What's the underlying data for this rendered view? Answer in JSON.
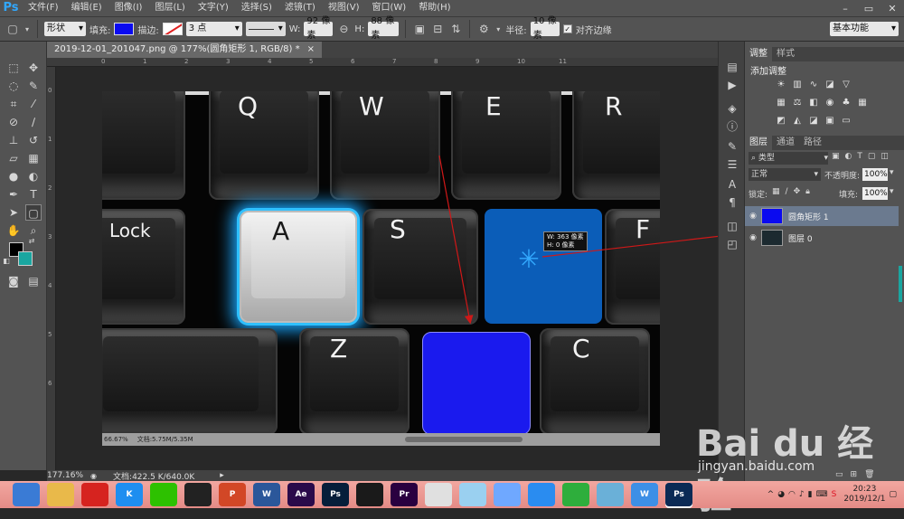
{
  "menubar": {
    "logo": "Ps",
    "items": [
      "文件(F)",
      "编辑(E)",
      "图像(I)",
      "图层(L)",
      "文字(Y)",
      "选择(S)",
      "滤镜(T)",
      "视图(V)",
      "窗口(W)",
      "帮助(H)"
    ]
  },
  "options": {
    "shape_mode": "形状",
    "fill_label": "填充:",
    "stroke_label": "描边:",
    "stroke_width": "3 点",
    "w_label": "W:",
    "w_value": "92 像素",
    "h_label": "H:",
    "h_value": "88 像素",
    "radius_label": "半径:",
    "radius_value": "10 像素",
    "align_edges": "对齐边缘",
    "workspace": "基本功能",
    "fill_color": "#0a0af0"
  },
  "document": {
    "tab_title": "2019-12-01_201047.png @ 177%(圆角矩形 1, RGB/8) *",
    "tab_close": "×",
    "zoom": "177.16%",
    "doc_size": "文档:422.5 K/640.0K"
  },
  "ruler": {
    "h_ticks": [
      "0",
      "1",
      "2",
      "3",
      "4",
      "5",
      "6",
      "7",
      "8",
      "9",
      "10",
      "11"
    ],
    "v_ticks": [
      "0",
      "1",
      "2",
      "3",
      "4",
      "5",
      "6"
    ]
  },
  "photo": {
    "keys": {
      "q": "Q",
      "w": "W",
      "e": "E",
      "r": "R",
      "lock": "Lock",
      "a": "A",
      "s": "S",
      "f": "F",
      "z": "Z",
      "c": "C"
    },
    "info_line1": "W: 363 像素",
    "info_line2": "H:    0 像素",
    "inner_zoom": "66.67%",
    "inner_doc": "文档:5.75M/5.35M"
  },
  "panels": {
    "adjust_tabs": [
      "调整",
      "样式"
    ],
    "adjust_title": "添加调整",
    "layer_tabs": [
      "图层",
      "通道",
      "路径"
    ],
    "filter_kind": "类型",
    "blend_mode": "正常",
    "opacity_label": "不透明度:",
    "opacity_value": "100%",
    "lock_label": "锁定:",
    "fill_label": "填充:",
    "fill_value": "100%",
    "layers": [
      {
        "name": "圆角矩形 1"
      },
      {
        "name": "图层 0"
      }
    ]
  },
  "taskbar": {
    "apps": [
      {
        "icon": "ie-icon",
        "label": "",
        "color": "#3a7bd5"
      },
      {
        "icon": "folder-icon",
        "label": "",
        "color": "#e9b94a"
      },
      {
        "icon": "netease-icon",
        "label": "",
        "color": "#d6231f"
      },
      {
        "icon": "kugou-icon",
        "label": "K",
        "color": "#1e8ef0"
      },
      {
        "icon": "wechat-icon",
        "label": "",
        "color": "#2dc100"
      },
      {
        "icon": "qq-icon",
        "label": "",
        "color": "#222222"
      },
      {
        "icon": "powerpoint-icon",
        "label": "P",
        "color": "#d24726"
      },
      {
        "icon": "word-icon",
        "label": "W",
        "color": "#2b579a"
      },
      {
        "icon": "aftereffects-icon",
        "label": "Ae",
        "color": "#2a0a4a"
      },
      {
        "icon": "photoshop-icon",
        "label": "Ps",
        "color": "#061e3a"
      },
      {
        "icon": "video-icon",
        "label": "",
        "color": "#1a1a1a"
      },
      {
        "icon": "premiere-icon",
        "label": "Pr",
        "color": "#2a0040"
      },
      {
        "icon": "chrome-icon",
        "label": "",
        "color": "#e0e0e0"
      },
      {
        "icon": "mascot-icon",
        "label": "",
        "color": "#9ad0f0"
      },
      {
        "icon": "feishu-icon",
        "label": "",
        "color": "#6fa8ff"
      },
      {
        "icon": "baidunetdisk-icon",
        "label": "",
        "color": "#2a8cf0"
      },
      {
        "icon": "green-app-icon",
        "label": "",
        "color": "#2eae3c"
      },
      {
        "icon": "notepad-icon",
        "label": "",
        "color": "#6ab0d8"
      },
      {
        "icon": "wps-icon",
        "label": "W",
        "color": "#3d8fe6"
      },
      {
        "icon": "photoshop-active-icon",
        "label": "Ps",
        "color": "#0b2a55"
      }
    ],
    "time": "20:23",
    "date": "2019/12/1"
  },
  "watermark": {
    "logo": "Bai du 经验",
    "url": "jingyan.baidu.com"
  }
}
